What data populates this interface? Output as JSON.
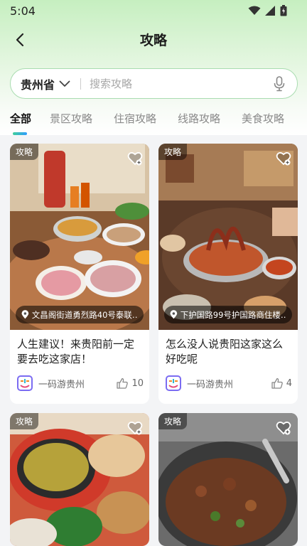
{
  "status_bar": {
    "time": "5:04"
  },
  "header": {
    "title": "攻略"
  },
  "search": {
    "region": "贵州省",
    "placeholder": "搜索攻略"
  },
  "tabs": [
    {
      "label": "全部",
      "active": true
    },
    {
      "label": "景区攻略",
      "active": false
    },
    {
      "label": "住宿攻略",
      "active": false
    },
    {
      "label": "线路攻略",
      "active": false
    },
    {
      "label": "美食攻略",
      "active": false
    }
  ],
  "cards": [
    {
      "tag": "攻略",
      "location": "文昌阁街道勇烈路40号泰联…",
      "title": "人生建议！来贵阳前一定要去吃这家店！",
      "author": "一码游贵州",
      "likes": "10"
    },
    {
      "tag": "攻略",
      "location": "下护国路99号护国路商住楼…",
      "title": "怎么没人说贵阳这家这么好吃呢",
      "author": "一码游贵州",
      "likes": "4"
    },
    {
      "tag": "攻略"
    },
    {
      "tag": "攻略"
    }
  ],
  "colors": {
    "accent_green": "#a9dcb0",
    "tab_indicator": [
      "#3fcf9a",
      "#2f9cff"
    ]
  }
}
